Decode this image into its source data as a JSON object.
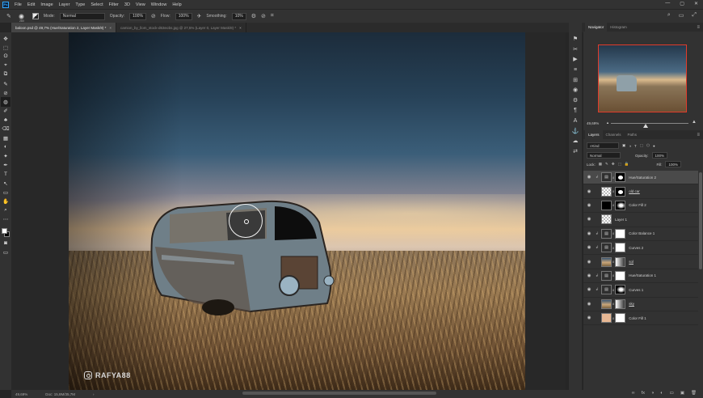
{
  "app": {
    "logo": "Ps"
  },
  "menu": [
    "File",
    "Edit",
    "Image",
    "Layer",
    "Type",
    "Select",
    "Filter",
    "3D",
    "View",
    "Window",
    "Help"
  ],
  "window_controls": [
    "—",
    "▢",
    "✕"
  ],
  "options": {
    "brush_size": "280",
    "mode_label": "Mode:",
    "mode_value": "Normal",
    "opacity_label": "Opacity:",
    "opacity_value": "100%",
    "flow_label": "Flow:",
    "flow_value": "100%",
    "smoothing_label": "Smoothing:",
    "smoothing_value": "10%",
    "right_icons": [
      "⌕",
      "▭",
      "⤢"
    ]
  },
  "doc_tabs": [
    {
      "label": "baloon.psd @ 49,7% (Hue/Saturation 2, Layer Mask/8) *",
      "close": "×",
      "active": true
    },
    {
      "label": "camion_by_llom_stock-d63eobs.jpg @ 27,5% (Layer 0, Layer Mask/8) *",
      "close": "×",
      "active": false
    }
  ],
  "tools": [
    "✥",
    "⬚",
    "ʘ",
    "⌖",
    "⧉",
    "✎",
    "⊘",
    "◍",
    "✐",
    "♣",
    "⌫",
    "▦",
    "◐",
    "✦",
    "✒",
    "T",
    "↖",
    "▭",
    "✋",
    "⌕",
    "⋯"
  ],
  "watermark": "RAFYA88",
  "status": {
    "zoom": "49,69%",
    "doc": "Doc: 15,8M/35,7M",
    "arrow": "›"
  },
  "icon_strip": [
    "⚑",
    "✂",
    "▶",
    "≡",
    "⊞",
    "◉",
    "⚙",
    "¶",
    "A",
    "⚓",
    "☁",
    "⇄"
  ],
  "navigator": {
    "tabs": [
      "Navigator",
      "Histogram"
    ],
    "menu": "≡",
    "zoom": "49,69%",
    "zoom_out": "▲",
    "zoom_in": "▲",
    "zoom_fraction": 0.45
  },
  "layers_panel": {
    "tabs": [
      "Layers",
      "Channels",
      "Paths"
    ],
    "menu": "≡",
    "filter_label": "Kind",
    "filter_icons": [
      "▣",
      "◑",
      "T",
      "⬚",
      "⬡",
      "●"
    ],
    "blend_mode": "Normal",
    "opacity_label": "Opacity:",
    "opacity_value": "100%",
    "lock_label": "Lock:",
    "lock_icons": [
      "▦",
      "✎",
      "✥",
      "⬚",
      "🔒"
    ],
    "fill_label": "Fill:",
    "fill_value": "100%",
    "eye": "◉",
    "chain": "8",
    "clip": "↲",
    "adj_glyph": "▤",
    "layers": [
      {
        "name": "Hue/Saturation 2",
        "thumb": "adj",
        "mask": "mask-blob",
        "clip": true,
        "selected": true,
        "underline": false
      },
      {
        "name": "old car",
        "thumb": "checker",
        "mask": "mask-blob",
        "clip": false,
        "selected": false,
        "underline": true
      },
      {
        "name": "Color Fill 2",
        "thumb": "black",
        "mask": "mask-dark",
        "clip": false,
        "selected": false,
        "underline": false
      },
      {
        "name": "Layer 1",
        "thumb": "checker",
        "mask": "",
        "clip": false,
        "selected": false,
        "underline": false
      },
      {
        "name": "Color Balance 1",
        "thumb": "adj",
        "mask": "white",
        "clip": true,
        "selected": false,
        "underline": false
      },
      {
        "name": "Curves 2",
        "thumb": "adj",
        "mask": "white",
        "clip": true,
        "selected": false,
        "underline": false
      },
      {
        "name": "sol",
        "thumb": "img",
        "mask": "mask-grad",
        "clip": false,
        "selected": false,
        "underline": true
      },
      {
        "name": "Hue/Saturation 1",
        "thumb": "adj",
        "mask": "white",
        "clip": true,
        "selected": false,
        "underline": false
      },
      {
        "name": "Curves 1",
        "thumb": "adj",
        "mask": "mask-dark",
        "clip": true,
        "selected": false,
        "underline": false
      },
      {
        "name": "sky",
        "thumb": "img",
        "mask": "mask-grad",
        "clip": false,
        "selected": false,
        "underline": true
      },
      {
        "name": "Color Fill 1",
        "thumb": "peach",
        "mask": "white",
        "clip": false,
        "selected": false,
        "underline": false
      }
    ],
    "footer_icons": [
      "∞",
      "fx",
      "◑",
      "◐",
      "▭",
      "▣",
      "🗑"
    ]
  }
}
